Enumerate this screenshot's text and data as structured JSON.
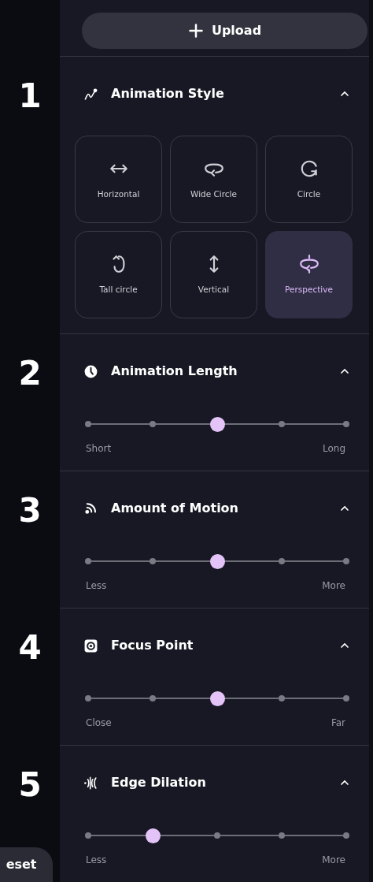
{
  "upload_button": {
    "label": "Upload"
  },
  "sections": [
    {
      "number": "1",
      "title": "Animation Style",
      "expanded": true,
      "kind": "tiles",
      "tiles": [
        {
          "label": "Horizontal",
          "selected": false
        },
        {
          "label": "Wide Circle",
          "selected": false
        },
        {
          "label": "Circle",
          "selected": false
        },
        {
          "label": "Tall circle",
          "selected": false
        },
        {
          "label": "Vertical",
          "selected": false
        },
        {
          "label": "Perspective",
          "selected": true
        }
      ]
    },
    {
      "number": "2",
      "title": "Animation Length",
      "expanded": true,
      "kind": "slider",
      "level": 0.5,
      "min_label": "Short",
      "max_label": "Long"
    },
    {
      "number": "3",
      "title": "Amount of Motion",
      "expanded": true,
      "kind": "slider",
      "level": 0.5,
      "min_label": "Less",
      "max_label": "More"
    },
    {
      "number": "4",
      "title": "Focus Point",
      "expanded": true,
      "kind": "slider",
      "level": 0.5,
      "min_label": "Close",
      "max_label": "Far"
    },
    {
      "number": "5",
      "title": "Edge Dilation",
      "expanded": true,
      "kind": "slider",
      "level": 0.25,
      "min_label": "Less",
      "max_label": "More"
    }
  ],
  "reset_button": {
    "label": "eset"
  }
}
